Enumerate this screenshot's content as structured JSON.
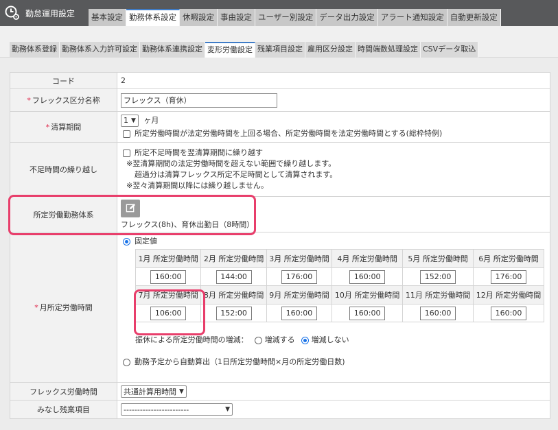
{
  "app": {
    "title": "勤怠運用設定"
  },
  "main_tabs": [
    "基本設定",
    "勤務体系設定",
    "休暇設定",
    "事由設定",
    "ユーザー別設定",
    "データ出力設定",
    "アラート通知設定",
    "自動更新設定"
  ],
  "sub_tabs": [
    "勤務体系登録",
    "勤務体系入力許可設定",
    "勤務体系連携設定",
    "変形労働設定",
    "残業項目設定",
    "雇用区分設定",
    "時間端数処理設定",
    "CSVデータ取込"
  ],
  "form": {
    "code": {
      "label": "コード",
      "value": "2"
    },
    "flex_name": {
      "label": "フレックス区分名称",
      "required": "*",
      "value": "フレックス（育休）"
    },
    "period": {
      "label": "清算期間",
      "required": "*",
      "select": "1",
      "unit": "ヶ月",
      "checkbox_label": "所定労働時間が法定労働時間を上回る場合、所定労働時間を法定労働時間とする(総枠特例)"
    },
    "carryover": {
      "label": "不足時間の繰り越し",
      "checkbox_label": "所定不足時間を翌清算期間に繰り越す",
      "note1": "※翌清算期間の法定労働時間を超えない範囲で繰り越します。",
      "note2": "超過分は清算フレックス所定不足時間として清算されます。",
      "note3": "※翌々清算期間以降には繰り越しません。"
    },
    "system": {
      "label": "所定労働勤務体系",
      "value": "フレックス(8h)、育休出勤日（8時間）"
    },
    "monthly": {
      "label": "月所定労働時間",
      "required": "*",
      "fixed_label": "固定値",
      "months": [
        {
          "label": "1月 所定労働時間",
          "value": "160:00"
        },
        {
          "label": "2月 所定労働時間",
          "value": "144:00"
        },
        {
          "label": "3月 所定労働時間",
          "value": "176:00"
        },
        {
          "label": "4月 所定労働時間",
          "value": "160:00"
        },
        {
          "label": "5月 所定労働時間",
          "value": "152:00"
        },
        {
          "label": "6月 所定労働時間",
          "value": "176:00"
        },
        {
          "label": "7月 所定労働時間",
          "value": "106:00"
        },
        {
          "label": "8月 所定労働時間",
          "value": "152:00"
        },
        {
          "label": "9月 所定労働時間",
          "value": "160:00"
        },
        {
          "label": "10月 所定労働時間",
          "value": "160:00"
        },
        {
          "label": "11月 所定労働時間",
          "value": "160:00"
        },
        {
          "label": "12月 所定労働時間",
          "value": "160:00"
        }
      ],
      "holiday_label": "振休による所定労働時間の増減：",
      "holiday_opt1": "増減する",
      "holiday_opt2": "増減しない",
      "auto_label": "勤務予定から自動算出（1日所定労働時間×月の所定労働日数)"
    },
    "flex_hours": {
      "label": "フレックス労働時間",
      "select": "共通計算用時間"
    },
    "overtime": {
      "label": "みなし残業項目",
      "select": "------------------------"
    }
  },
  "colors": {
    "highlight": "#e83e6b",
    "accent": "#3f7cc7",
    "header": "#58595b"
  }
}
